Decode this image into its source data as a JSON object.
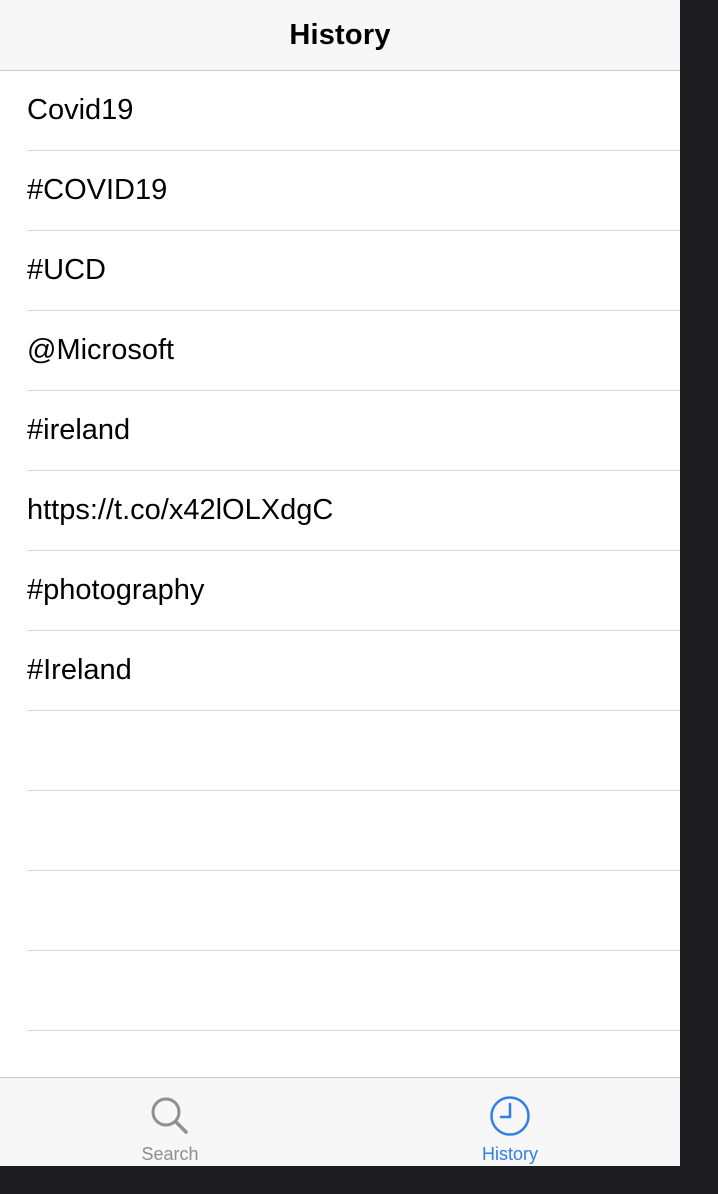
{
  "navbar": {
    "title": "History"
  },
  "history": {
    "items": [
      "Covid19",
      "#COVID19",
      "#UCD",
      "@Microsoft",
      "#ireland",
      "https://t.co/x42lOLXdgC",
      "#photography",
      "#Ireland"
    ]
  },
  "tabbar": {
    "tabs": [
      {
        "label": "Search",
        "icon": "search-icon",
        "selected": false
      },
      {
        "label": "History",
        "icon": "clock-icon",
        "selected": true
      }
    ]
  },
  "colors": {
    "accent": "#2f7fe8",
    "inactive": "#8e8e93",
    "bar_background": "#f7f7f7",
    "separator": "#d8d8dc"
  }
}
